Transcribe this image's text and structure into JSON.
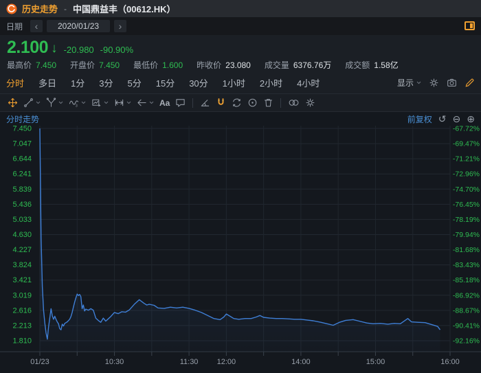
{
  "window": {
    "title_app": "历史走势",
    "separator": "-",
    "stock_name": "中国鼎益丰（00612.HK）"
  },
  "date_bar": {
    "label": "日期",
    "prev": "‹",
    "value": "2020/01/23",
    "next": "›"
  },
  "quote": {
    "price": "2.100",
    "arrow": "↓",
    "direction": "down",
    "change": "-20.980",
    "change_pct": "-90.90%",
    "stats": [
      {
        "label": "最高价",
        "value": "7.450",
        "color": "green"
      },
      {
        "label": "开盘价",
        "value": "7.450",
        "color": "green"
      },
      {
        "label": "最低价",
        "value": "1.600",
        "color": "green"
      },
      {
        "label": "昨收价",
        "value": "23.080",
        "color": "white"
      },
      {
        "label": "成交量",
        "value": "6376.76万",
        "color": "white"
      },
      {
        "label": "成交额",
        "value": "1.58亿",
        "color": "white"
      }
    ]
  },
  "period_tabs": {
    "items": [
      {
        "label": "分时",
        "active": true
      },
      {
        "label": "多日",
        "active": false
      },
      {
        "label": "1分",
        "active": false
      },
      {
        "label": "3分",
        "active": false
      },
      {
        "label": "5分",
        "active": false
      },
      {
        "label": "15分",
        "active": false
      },
      {
        "label": "30分",
        "active": false
      },
      {
        "label": "1小时",
        "active": false
      },
      {
        "label": "2小时",
        "active": false
      },
      {
        "label": "4小时",
        "active": false
      }
    ],
    "display_label": "显示",
    "right_icons": [
      "settings-gear-icon",
      "camera-icon",
      "pencil-edit-icon"
    ]
  },
  "draw_toolbar": {
    "text_tool_label": "Aa",
    "wave_tool_sub": "3",
    "icons": [
      "move-tool",
      "trend-line-tool",
      "pitchfork-tool",
      "wave-tool",
      "pattern-tool",
      "measure-tool",
      "arrow-tool",
      "text-tool",
      "comment-bubble-tool",
      "angle-tool",
      "magnet-tool",
      "swap-cycle-tool",
      "target-tool",
      "trash-tool",
      "link-circles-tool",
      "gear-tool"
    ]
  },
  "chart_header": {
    "adjust_label": "前复权",
    "undo_icon": "↺",
    "zoom_out_icon": "⊖",
    "zoom_in_icon": "⊕"
  },
  "chart_data": {
    "type": "line",
    "title": "分时走势",
    "ylim": [
      1.81,
      7.45
    ],
    "grid": true,
    "x_axis": {
      "session_minutes": 330,
      "gridline_every_min": 30,
      "labels": [
        {
          "text": "01/23",
          "minute": 0
        },
        {
          "text": "10:30",
          "minute": 60
        },
        {
          "text": "11:30",
          "minute": 120
        },
        {
          "text": "12:00",
          "minute": 150
        },
        {
          "text": "14:00",
          "minute": 210
        },
        {
          "text": "15:00",
          "minute": 270
        },
        {
          "text": "16:00",
          "minute": 330
        }
      ]
    },
    "y_axis_left": {
      "ticks": [
        "7.450",
        "7.047",
        "6.644",
        "6.241",
        "5.839",
        "5.436",
        "5.033",
        "4.630",
        "4.227",
        "3.824",
        "3.421",
        "3.019",
        "2.616",
        "2.213",
        "1.810"
      ]
    },
    "y_axis_right": {
      "ticks": [
        "-67.72%",
        "-69.47%",
        "-71.21%",
        "-72.96%",
        "-74.70%",
        "-76.45%",
        "-78.19%",
        "-79.94%",
        "-81.68%",
        "-83.43%",
        "-85.18%",
        "-86.92%",
        "-88.67%",
        "-90.41%",
        "-92.16%"
      ]
    },
    "series": [
      {
        "name": "price",
        "color": "#3f7fd6",
        "x_minutes": [
          0,
          1,
          2,
          3,
          4,
          5,
          6,
          7,
          8,
          9,
          10,
          11,
          12,
          13,
          14,
          15,
          16,
          17,
          18,
          19,
          20,
          22,
          24,
          25,
          26,
          27,
          28,
          29,
          30,
          31,
          32,
          33,
          34,
          35,
          36,
          37,
          39,
          41,
          43,
          45,
          47,
          49,
          51,
          53,
          55,
          57,
          60,
          63,
          66,
          69,
          72,
          76,
          80,
          84,
          86,
          88,
          92,
          95,
          100,
          105,
          110,
          115,
          120,
          125,
          130,
          135,
          140,
          145,
          148,
          150,
          153,
          156,
          160,
          165,
          170,
          174,
          177,
          180,
          185,
          190,
          195,
          200,
          205,
          210,
          215,
          220,
          226,
          231,
          236,
          241,
          246,
          252,
          257,
          263,
          268,
          274,
          280,
          285,
          290,
          296,
          299,
          304,
          310,
          315,
          320,
          322
        ],
        "values": [
          7.45,
          4.55,
          3.25,
          2.62,
          2.28,
          2.02,
          1.85,
          2.18,
          2.42,
          2.66,
          2.47,
          2.38,
          2.46,
          2.38,
          2.31,
          2.26,
          2.13,
          2.1,
          2.25,
          2.2,
          2.27,
          2.31,
          2.38,
          2.45,
          2.56,
          2.7,
          2.84,
          2.95,
          3.05,
          3.01,
          3.04,
          2.98,
          2.66,
          2.76,
          2.6,
          2.65,
          2.62,
          2.66,
          2.62,
          2.41,
          2.35,
          2.3,
          2.41,
          2.33,
          2.39,
          2.45,
          2.56,
          2.53,
          2.58,
          2.57,
          2.63,
          2.78,
          2.9,
          2.8,
          2.76,
          2.78,
          2.75,
          2.68,
          2.67,
          2.7,
          2.68,
          2.7,
          2.67,
          2.62,
          2.56,
          2.48,
          2.4,
          2.37,
          2.44,
          2.52,
          2.46,
          2.4,
          2.38,
          2.4,
          2.4,
          2.44,
          2.48,
          2.43,
          2.41,
          2.4,
          2.4,
          2.39,
          2.38,
          2.38,
          2.36,
          2.34,
          2.3,
          2.26,
          2.22,
          2.3,
          2.35,
          2.37,
          2.33,
          2.28,
          2.26,
          2.27,
          2.25,
          2.27,
          2.26,
          2.4,
          2.31,
          2.3,
          2.29,
          2.24,
          2.19,
          2.1
        ]
      }
    ]
  },
  "colors": {
    "accent_orange": "#f0a030",
    "down_green": "#2fbd52",
    "line_blue": "#3f7fd6",
    "header_blue": "#4a8fd4",
    "grid": "#222831",
    "axis_text": "#98a0aa"
  }
}
